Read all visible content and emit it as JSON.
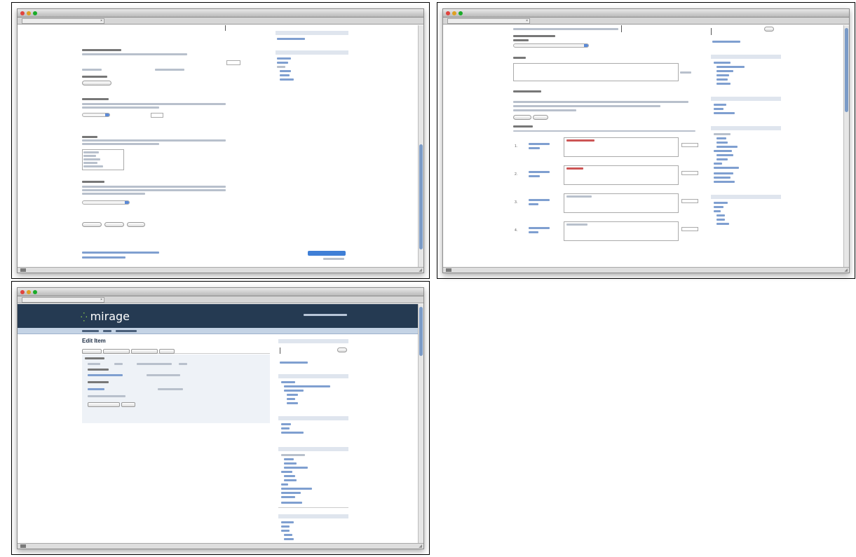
{
  "windows": [
    {
      "id": "a",
      "tab_label": "",
      "title_bar": ""
    },
    {
      "id": "b",
      "tab_label": "",
      "title_bar": ""
    },
    {
      "id": "c",
      "tab_label": "",
      "title_bar": ""
    }
  ],
  "mirage": {
    "logo": "mirage",
    "page_title": "Edit Item"
  },
  "colors": {
    "header_bg": "#253a52",
    "nav_bg": "#c4d3e5",
    "link": "#2a5db0",
    "logo_accent": "#8fd14f",
    "scroll_thumb": "#7b9bc7"
  }
}
